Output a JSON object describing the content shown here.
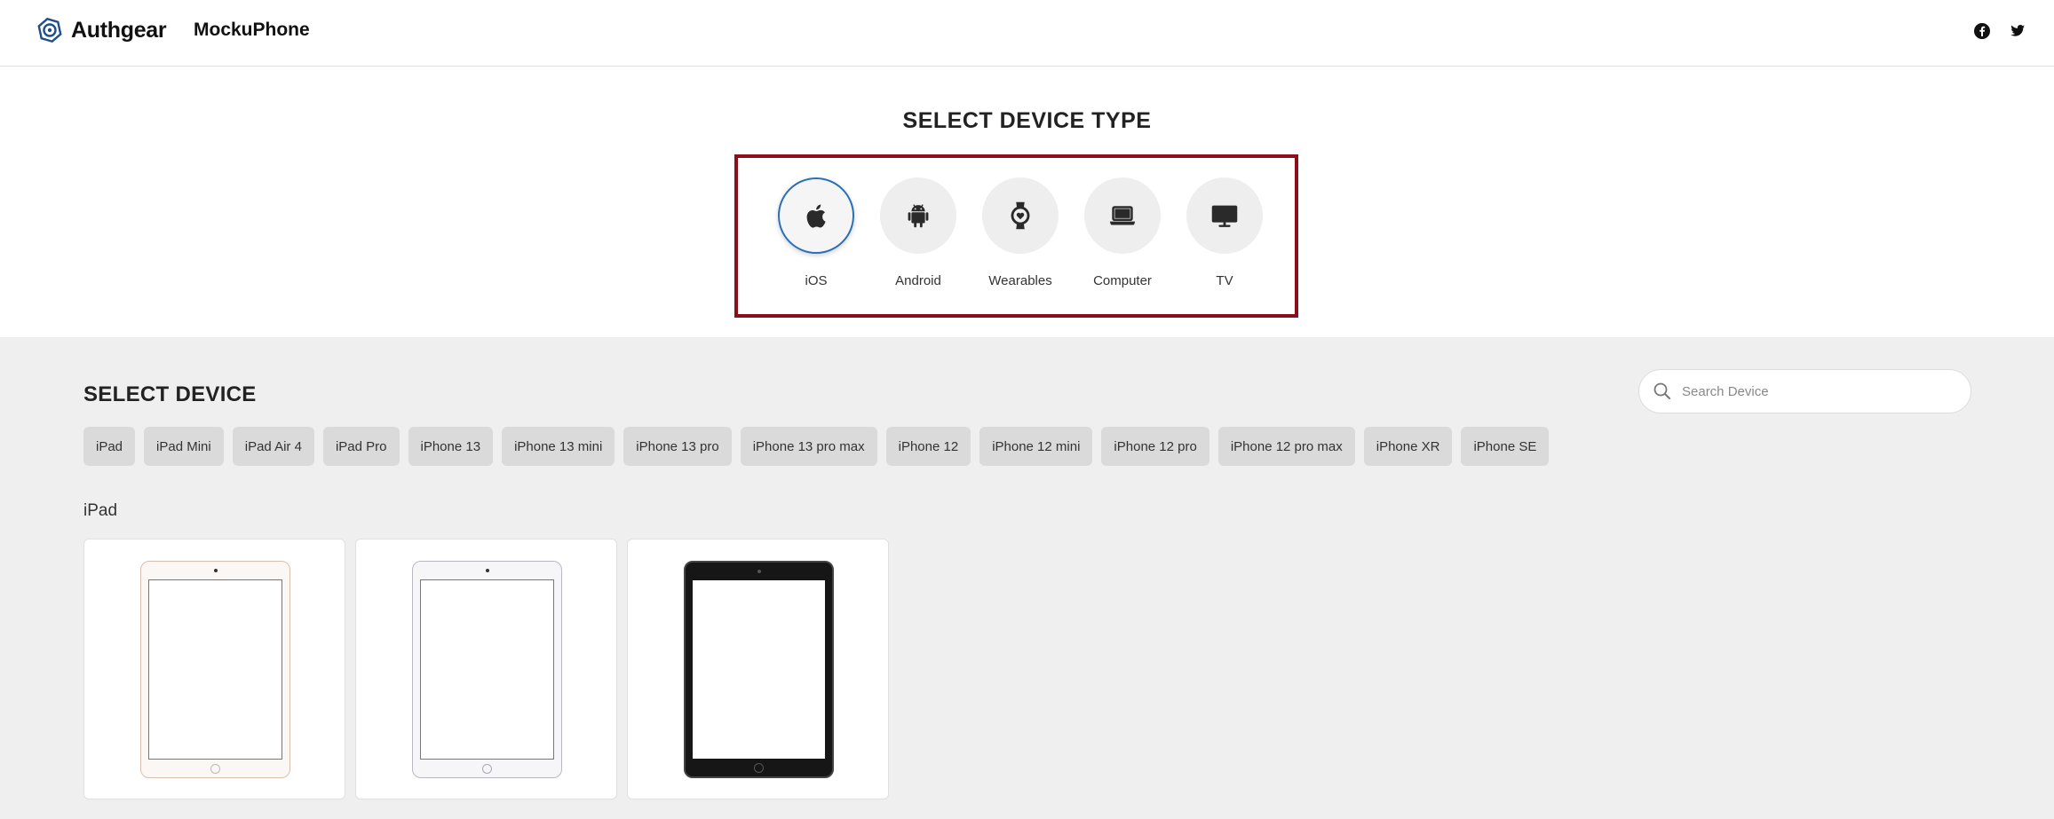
{
  "header": {
    "brand": "Authgear",
    "product": "MockuPhone",
    "social": [
      "facebook-icon",
      "twitter-icon"
    ]
  },
  "device_type": {
    "title": "SELECT DEVICE TYPE",
    "highlight_color": "#8b0f18",
    "active_color": "#2a6fb8",
    "items": [
      {
        "label": "iOS",
        "icon": "apple-icon",
        "active": true
      },
      {
        "label": "Android",
        "icon": "android-icon",
        "active": false
      },
      {
        "label": "Wearables",
        "icon": "smartwatch-icon",
        "active": false
      },
      {
        "label": "Computer",
        "icon": "laptop-icon",
        "active": false
      },
      {
        "label": "TV",
        "icon": "tv-icon",
        "active": false
      }
    ]
  },
  "device": {
    "title": "SELECT DEVICE",
    "search": {
      "placeholder": "Search Device",
      "value": ""
    },
    "chips": [
      "iPad",
      "iPad Mini",
      "iPad Air 4",
      "iPad Pro",
      "iPhone 13",
      "iPhone 13 mini",
      "iPhone 13 pro",
      "iPhone 13 pro max",
      "iPhone 12",
      "iPhone 12 mini",
      "iPhone 12 pro",
      "iPhone 12 pro max",
      "iPhone XR",
      "iPhone SE"
    ],
    "group": {
      "title": "iPad",
      "cards": [
        {
          "variant": "gold"
        },
        {
          "variant": "silver"
        },
        {
          "variant": "black"
        }
      ]
    }
  }
}
